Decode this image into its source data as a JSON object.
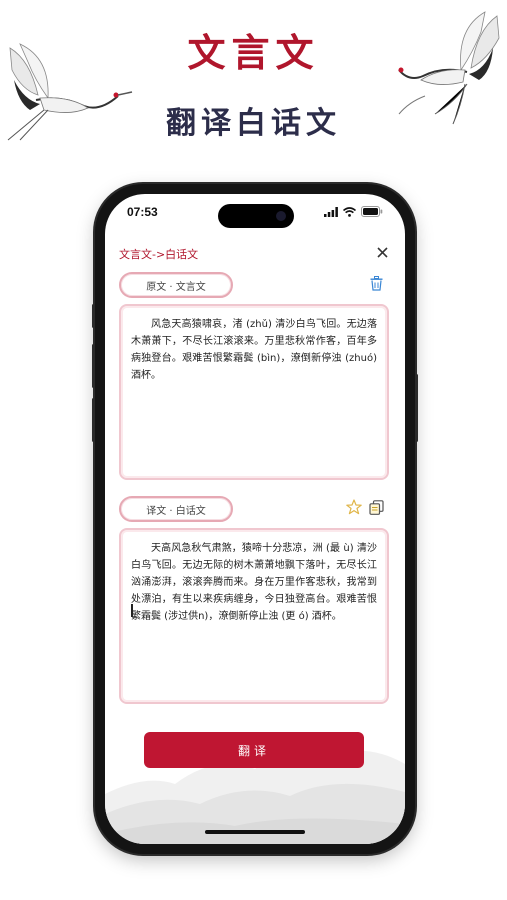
{
  "promo": {
    "title": "文言文",
    "subtitle": "翻译白话文"
  },
  "status_bar": {
    "time": "07:53"
  },
  "nav": {
    "title": "文言文->白话文"
  },
  "source": {
    "label": "原文 · 文言文",
    "text": "风急天高猿啸哀，渚 (zhǔ) 清沙白鸟飞回。无边落木萧萧下，不尽长江滚滚来。万里悲秋常作客，百年多病独登台。艰难苦恨繁霜鬓 (bìn)，潦倒新停浊 (zhuó) 酒杯。"
  },
  "translation": {
    "label": "译文 · 白话文",
    "text": "天高风急秋气肃煞，猿啼十分悲凉，洲 (最 ù) 清沙白鸟飞回。无边无际的树木萧萧地飘下落叶，无尽长江汹涌澎湃，滚滚奔腾而来。身在万里作客悲秋，我常到处漂泊，有生以来疾病缠身，今日独登高台。艰难苦恨繁霜鬓 (涉过供n)，潦倒新停止浊 (更 ó) 酒杯。"
  },
  "actions": {
    "translate_label": "翻译"
  },
  "colors": {
    "accent": "#bf1632",
    "promo_title": "#b0162c",
    "promo_subtitle": "#2c2d4a",
    "pill_border": "#e6a9b4"
  },
  "icons": [
    "trash-icon",
    "star-icon",
    "copy-icon",
    "close-icon",
    "wifi-icon",
    "battery-icon",
    "signal-icon"
  ]
}
